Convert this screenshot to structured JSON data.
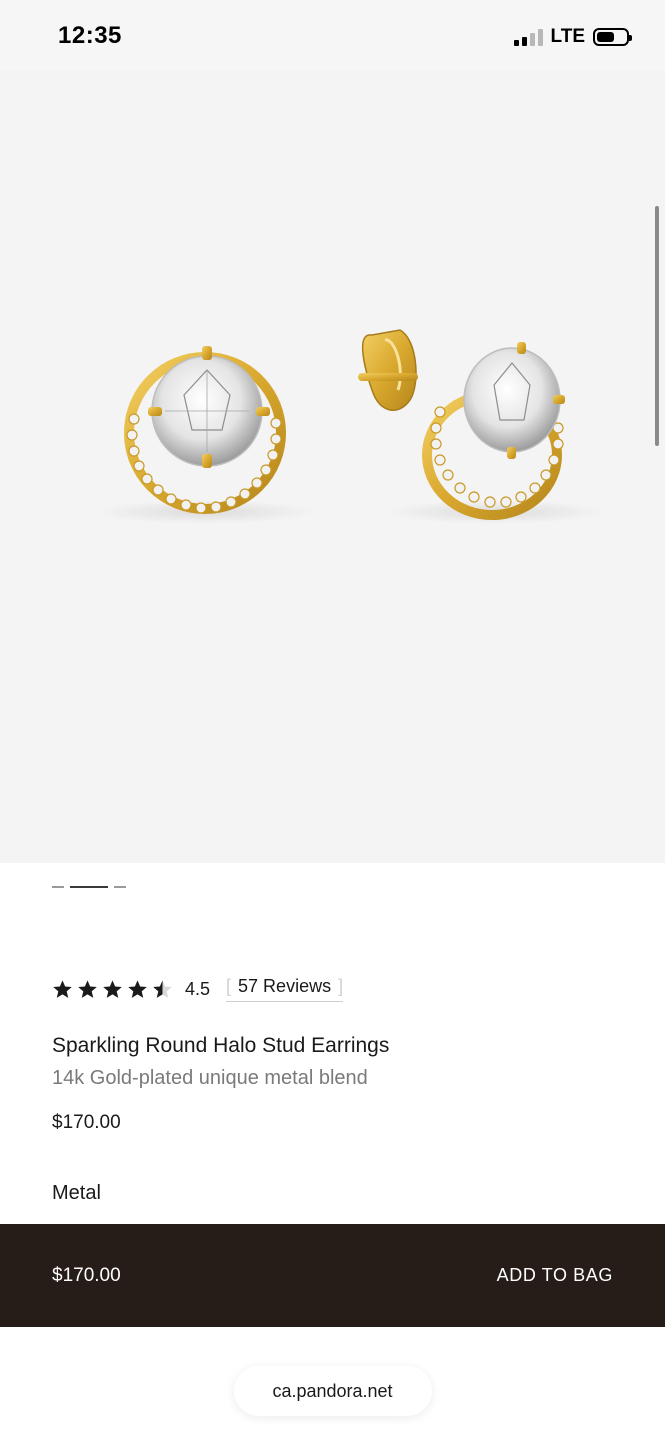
{
  "status_bar": {
    "time": "12:35",
    "network": "LTE",
    "battery_level": 0.62
  },
  "product": {
    "rating": {
      "stars": 4.5,
      "value": "4.5",
      "reviews_label": "57 Reviews"
    },
    "title": "Sparkling Round Halo Stud Earrings",
    "subtitle": "14k Gold-plated unique metal blend",
    "price": "$170.00",
    "metal_label": "Metal"
  },
  "carousel": {
    "active_index": 1,
    "count": 3
  },
  "cta": {
    "price": "$170.00",
    "button_label": "ADD TO BAG"
  },
  "browser": {
    "url": "ca.pandora.net"
  },
  "colors": {
    "cta_background": "#261c18",
    "gold": "#d9a82e",
    "hero_background": "#f4f4f4"
  },
  "icons": {
    "star": "star-icon",
    "battery": "battery-icon",
    "signal": "signal-icon"
  }
}
